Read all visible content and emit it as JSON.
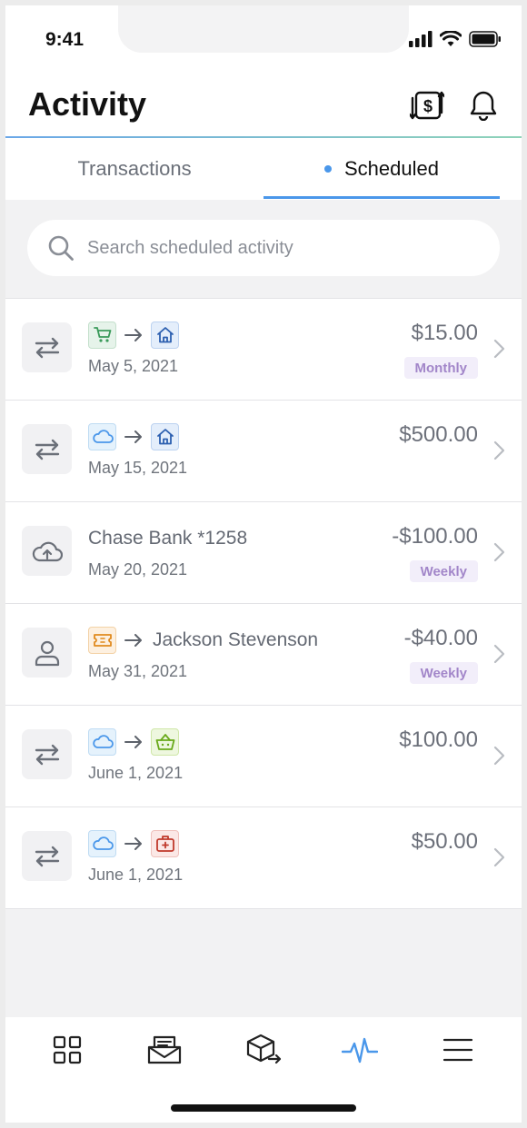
{
  "status_bar": {
    "time": "9:41"
  },
  "header": {
    "title": "Activity",
    "exchange_icon": "dollar-exchange-icon",
    "bell_icon": "bell-icon"
  },
  "tabs": [
    {
      "label": "Transactions",
      "active": false
    },
    {
      "label": "Scheduled",
      "active": true
    }
  ],
  "search": {
    "placeholder": "Search scheduled activity"
  },
  "colors": {
    "accent": "#4a97ea",
    "badge_bg": "#f2eefa",
    "badge_text": "#a286c9"
  },
  "rows": [
    {
      "icon": "transfer-icon",
      "from": "cart-icon",
      "to": "home-icon",
      "date": "May 5, 2021",
      "amount": "$15.00",
      "badge": "Monthly"
    },
    {
      "icon": "transfer-icon",
      "from": "cloud-icon",
      "to": "home-icon",
      "date": "May 15, 2021",
      "amount": "$500.00",
      "badge": ""
    },
    {
      "icon": "cloud-upload-icon",
      "name": "Chase Bank *1258",
      "date": "May 20, 2021",
      "amount": "-$100.00",
      "badge": "Weekly"
    },
    {
      "icon": "person-icon",
      "from": "ticket-icon",
      "name": "Jackson Stevenson",
      "date": "May 31, 2021",
      "amount": "-$40.00",
      "badge": "Weekly"
    },
    {
      "icon": "transfer-icon",
      "from": "cloud-icon",
      "to": "basket-icon",
      "date": "June 1, 2021",
      "amount": "$100.00",
      "badge": ""
    },
    {
      "icon": "transfer-icon",
      "from": "cloud-icon",
      "to": "medkit-icon",
      "date": "June 1, 2021",
      "amount": "$50.00",
      "badge": ""
    }
  ],
  "bottom_nav": [
    {
      "icon": "grid-icon",
      "active": false
    },
    {
      "icon": "mail-tray-icon",
      "active": false
    },
    {
      "icon": "box-send-icon",
      "active": false
    },
    {
      "icon": "activity-pulse-icon",
      "active": true
    },
    {
      "icon": "menu-icon",
      "active": false
    }
  ]
}
